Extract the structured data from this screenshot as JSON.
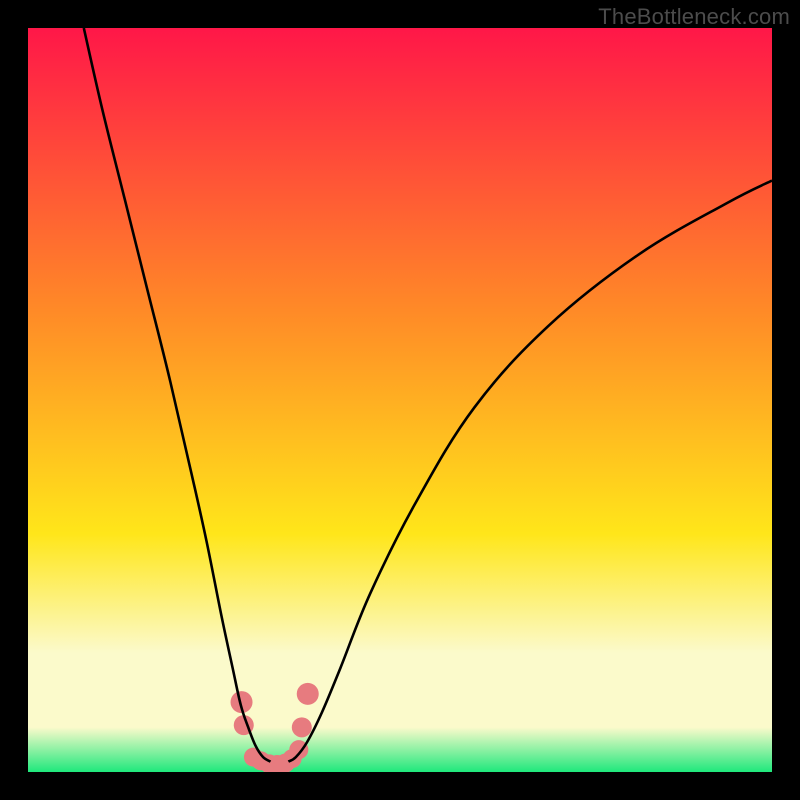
{
  "watermark": "TheBottleneck.com",
  "colors": {
    "frame": "#000000",
    "curve": "#000000",
    "marker": "#e77b7f",
    "gradient_top": "#ff1748",
    "gradient_mid1": "#ff8a27",
    "gradient_mid2": "#ffe61a",
    "gradient_band": "#fbfacb",
    "gradient_bottom": "#1fe87c"
  },
  "chart_data": {
    "type": "line",
    "title": "",
    "xlabel": "",
    "ylabel": "",
    "xlim": [
      0,
      100
    ],
    "ylim": [
      0,
      100
    ],
    "series": [
      {
        "name": "curve-left",
        "x": [
          7.5,
          10,
          13,
          16,
          19,
          22,
          24,
          26,
          27.5,
          28.6,
          29.6,
          30.6,
          31.6,
          32.6
        ],
        "y": [
          100,
          89,
          77,
          65,
          53,
          40,
          31,
          21,
          14,
          9,
          6,
          3.5,
          2,
          1.4
        ]
      },
      {
        "name": "curve-right",
        "x": [
          35,
          36,
          37.5,
          39.5,
          42,
          46,
          52,
          60,
          70,
          82,
          94,
          100
        ],
        "y": [
          1.4,
          2,
          4,
          8,
          14,
          24,
          36,
          49,
          60,
          69.5,
          76.5,
          79.5
        ]
      }
    ],
    "markers": {
      "name": "bottom-points",
      "x": [
        28.7,
        29.0,
        30.3,
        31.3,
        32.4,
        33.5,
        34.6,
        35.5,
        36.4,
        36.8,
        37.6
      ],
      "y": [
        9.4,
        6.3,
        2.0,
        1.5,
        1.1,
        1.0,
        1.2,
        1.8,
        3.0,
        6.0,
        10.5
      ],
      "r": [
        11,
        10,
        9.5,
        9.5,
        9.5,
        9.5,
        9.5,
        9.5,
        9.5,
        10,
        11
      ]
    }
  }
}
